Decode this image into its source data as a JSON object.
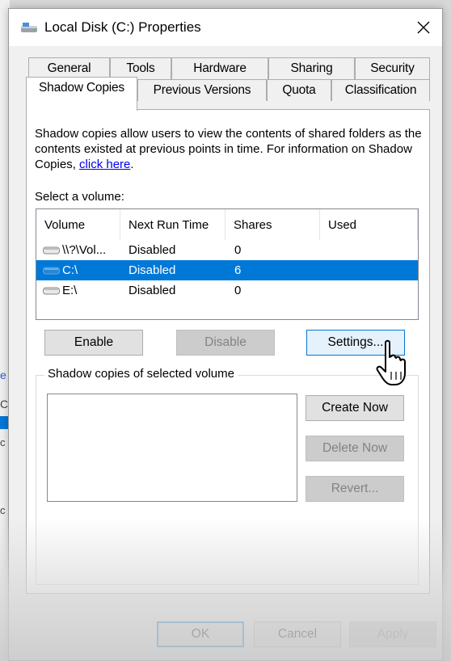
{
  "window": {
    "title": "Local Disk (C:) Properties"
  },
  "tabs_row1": [
    "General",
    "Tools",
    "Hardware",
    "Sharing",
    "Security"
  ],
  "tabs_row2": [
    "Shadow Copies",
    "Previous Versions",
    "Quota",
    "Classification"
  ],
  "active_tab": "Shadow Copies",
  "description": {
    "text": "Shadow copies allow users to view the contents of shared folders as the contents existed at previous points in time. For information on Shadow Copies, ",
    "link": "click here",
    "suffix": "."
  },
  "volumes": {
    "label": "Select a volume:",
    "columns": [
      "Volume",
      "Next Run Time",
      "Shares",
      "Used"
    ],
    "rows": [
      {
        "volume": "\\\\?\\Vol...",
        "next_run": "Disabled",
        "shares": "0",
        "used": "",
        "selected": false
      },
      {
        "volume": "C:\\",
        "next_run": "Disabled",
        "shares": "6",
        "used": "",
        "selected": true
      },
      {
        "volume": "E:\\",
        "next_run": "Disabled",
        "shares": "0",
        "used": "",
        "selected": false
      }
    ]
  },
  "buttons": {
    "enable": "Enable",
    "disable": "Disable",
    "settings": "Settings...",
    "create_now": "Create Now",
    "delete_now": "Delete Now",
    "revert": "Revert..."
  },
  "copies_group": {
    "label": "Shadow copies of selected volume"
  },
  "footer": {
    "ok": "OK",
    "cancel": "Cancel",
    "apply": "Apply"
  },
  "background_fragments": [
    "e",
    "C",
    "c",
    "c"
  ],
  "colors": {
    "selection": "#0078d7",
    "link": "#0000ee",
    "focus_border": "#0078d7"
  }
}
